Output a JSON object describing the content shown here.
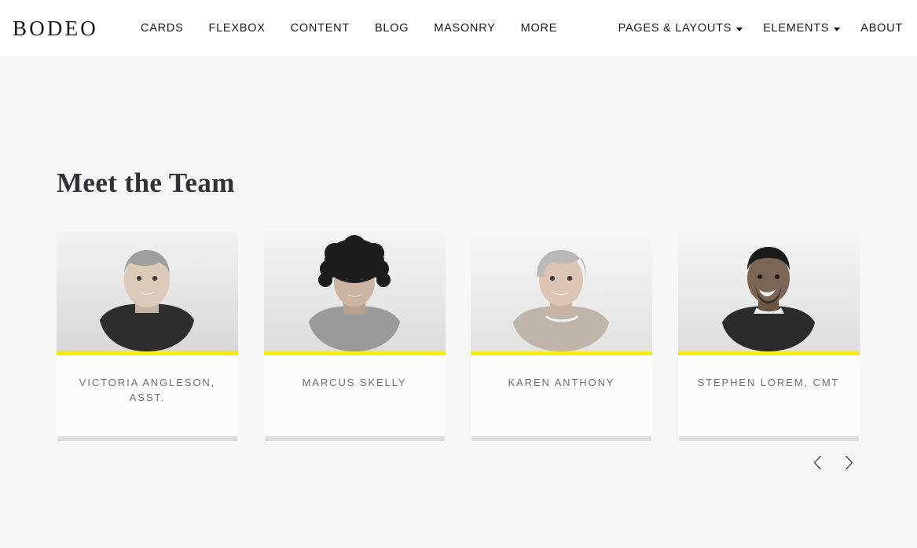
{
  "header": {
    "brand": "BODEO",
    "nav_left": [
      {
        "label": "CARDS",
        "has_dropdown": false
      },
      {
        "label": "FLEXBOX",
        "has_dropdown": false
      },
      {
        "label": "CONTENT",
        "has_dropdown": false
      },
      {
        "label": "BLOG",
        "has_dropdown": false
      },
      {
        "label": "MASONRY",
        "has_dropdown": false
      },
      {
        "label": "MORE",
        "has_dropdown": false
      }
    ],
    "nav_right": [
      {
        "label": "PAGES & LAYOUTS",
        "has_dropdown": true
      },
      {
        "label": "ELEMENTS",
        "has_dropdown": true
      },
      {
        "label": "ABOUT",
        "has_dropdown": false
      }
    ]
  },
  "main": {
    "section_title": "Meet the Team",
    "team": [
      {
        "name": "VICTORIA ANGLESON, ASST.",
        "photo_alt": "portrait-victoria-angleson"
      },
      {
        "name": "MARCUS SKELLY",
        "photo_alt": "portrait-marcus-skelly"
      },
      {
        "name": "KAREN ANTHONY",
        "photo_alt": "portrait-karen-anthony"
      },
      {
        "name": "STEPHEN LOREM, CMT",
        "photo_alt": "portrait-stephen-lorem"
      }
    ],
    "carousel": {
      "prev_icon": "chevron-left-icon",
      "next_icon": "chevron-right-icon"
    }
  },
  "colors": {
    "accent_yellow": "#f4ec0b",
    "page_background": "#f5f6f5",
    "header_background": "#ffffff",
    "text_dark": "#16181d",
    "text_muted": "#6b6e70",
    "card_shadow": "#dcdcdc"
  }
}
